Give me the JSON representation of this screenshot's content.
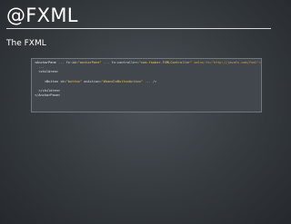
{
  "slide": {
    "title": "@FXML",
    "subtitle": "The FXML"
  },
  "code": {
    "line1": {
      "open": "<AnchorPane",
      "gap1": " ... ",
      "attr_id": "fx:id=",
      "val_id": "\"anchorPane\"",
      "gap2": " ... ",
      "attr_ctrl": "fx:controller=",
      "val_ctrl": "\"com.foobar.FXMLController\"",
      "rest": " xmlns:fx=\"http://javafx.com/fxml\">"
    },
    "line2": "  ...",
    "line3": "  <children>",
    "line4": {
      "indent": "     <Button",
      "attr_id": " id=",
      "val_id": "\"button\"",
      "attr_action": " onAction=",
      "val_action": "\"#handleButtonAction\"",
      "rest": " ... />"
    },
    "line5": "  </children>",
    "line6": "</AnchorPane>"
  }
}
